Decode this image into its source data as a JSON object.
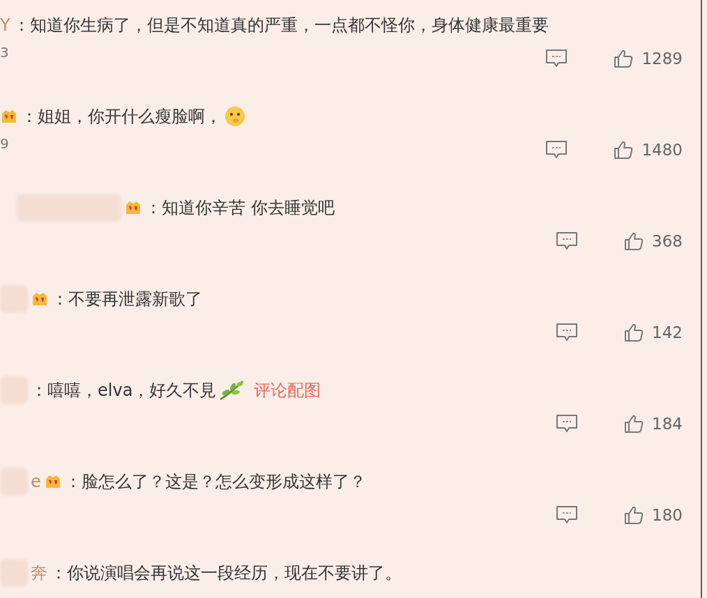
{
  "comments": [
    {
      "parts": [
        {
          "kind": "name",
          "text": "Y"
        },
        {
          "kind": "text",
          "text": "：知道你生病了，但是不知道真的严重，一点都不怪你，身体健康最重要"
        }
      ],
      "note": "3",
      "likes": "1289"
    },
    {
      "parts": [
        {
          "kind": "badge"
        },
        {
          "kind": "text",
          "text": "：姐姐，你开什么瘦脸啊，"
        },
        {
          "kind": "face"
        }
      ],
      "note": "9",
      "likes": "1480"
    },
    {
      "parts": [
        {
          "kind": "smear"
        },
        {
          "kind": "badge"
        },
        {
          "kind": "text",
          "text": "：知道你辛苦 你去睡觉吧"
        }
      ],
      "likes": "368"
    },
    {
      "parts": [
        {
          "kind": "blur"
        },
        {
          "kind": "badge"
        },
        {
          "kind": "text",
          "text": "：不要再泄露新歌了"
        }
      ],
      "likes": "142"
    },
    {
      "parts": [
        {
          "kind": "blur"
        },
        {
          "kind": "text",
          "text": "：嘻嘻，elva，好久不見"
        },
        {
          "kind": "leaf"
        },
        {
          "kind": "link",
          "text": "评论配图"
        }
      ],
      "likes": "184"
    },
    {
      "parts": [
        {
          "kind": "blur"
        },
        {
          "kind": "name",
          "text": "e"
        },
        {
          "kind": "badge"
        },
        {
          "kind": "text",
          "text": "：脸怎么了？这是？怎么变形成这样了？"
        }
      ],
      "likes": "180"
    },
    {
      "parts": [
        {
          "kind": "blur"
        },
        {
          "kind": "name",
          "text": "奔"
        },
        {
          "kind": "text",
          "text": "：你说演唱会再说这一段经历，现在不要讲了。"
        }
      ]
    }
  ]
}
